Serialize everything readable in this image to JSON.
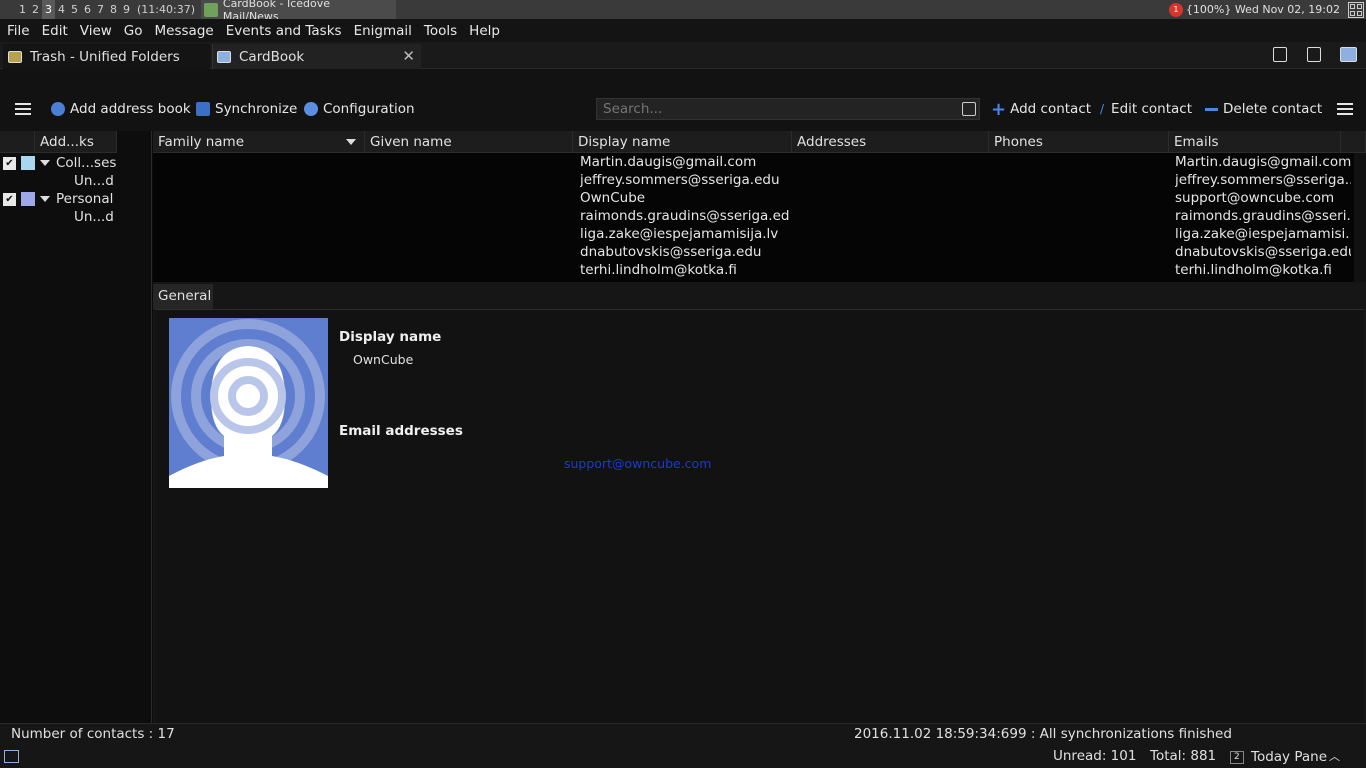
{
  "sysbar": {
    "workspaces": [
      "1",
      "2",
      "3",
      "4",
      "5",
      "6",
      "7",
      "8",
      "9"
    ],
    "clock": "(11:40:37)",
    "window_title": "CardBook - Icedove Mail/News",
    "notification_count": "1",
    "tray_text": "{100%} Wed Nov 02, 19:02"
  },
  "menubar": [
    "File",
    "Edit",
    "View",
    "Go",
    "Message",
    "Events and Tasks",
    "Enigmail",
    "Tools",
    "Help"
  ],
  "tabs": {
    "tab1": "Trash - Unified Folders",
    "tab2": "CardBook",
    "close": "✕"
  },
  "toolbar": {
    "add_address_book": "Add address book",
    "synchronize": "Synchronize",
    "configuration": "Configuration",
    "search_placeholder": "Search...",
    "add_contact": "Add contact",
    "edit_contact": "Edit contact",
    "delete_contact": "Delete contact"
  },
  "addressbooks": {
    "header": "Add...ks",
    "items": [
      {
        "name": "Coll...ses",
        "color": "#a9d7ef",
        "sub": "Un...d"
      },
      {
        "name": "Personal",
        "color": "#9ea8e8",
        "sub": "Un...d"
      }
    ]
  },
  "contacts": {
    "columns": [
      "Family name",
      "Given name",
      "Display name",
      "Addresses",
      "Phones",
      "Emails"
    ],
    "rows": [
      {
        "display": "Martin.daugis@gmail.com",
        "email": "Martin.daugis@gmail.com"
      },
      {
        "display": "jeffrey.sommers@sseriga.edu",
        "email": "jeffrey.sommers@sseriga..."
      },
      {
        "display": "OwnCube",
        "email": "support@owncube.com"
      },
      {
        "display": "raimonds.graudins@sseriga.edu",
        "email": "raimonds.graudins@sseri..."
      },
      {
        "display": "liga.zake@iespejamamisija.lv",
        "email": "liga.zake@iespejamamisi..."
      },
      {
        "display": "dnabutovskis@sseriga.edu",
        "email": "dnabutovskis@sseriga.edu"
      },
      {
        "display": "terhi.lindholm@kotka.fi",
        "email": "terhi.lindholm@kotka.fi"
      }
    ]
  },
  "detail": {
    "tab": "General",
    "display_name_label": "Display name",
    "display_name_value": "OwnCube",
    "email_label": "Email addresses",
    "email_value": "support@owncube.com"
  },
  "status": {
    "contacts_count": "Number of contacts : 17",
    "sync_message": "2016.11.02 18:59:34:699 : All synchronizations finished",
    "unread": "Unread: 101",
    "total": "Total: 881",
    "today_badge": "2",
    "today_pane": "Today Pane"
  },
  "colors": {
    "link": "#1a3ad8",
    "avatar_bg": "#5f7ed0"
  }
}
